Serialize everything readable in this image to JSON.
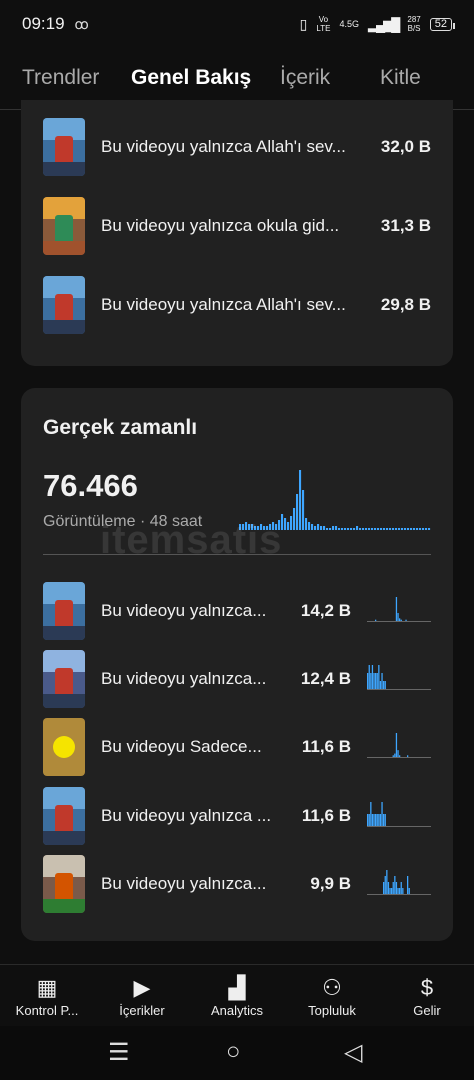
{
  "status_bar": {
    "time": "09:19",
    "link_icon": "link-icon",
    "vo": "Vo",
    "lte": "LTE",
    "network": "4.5G",
    "speed_value": "287",
    "speed_unit": "B/S",
    "battery": "52"
  },
  "tabs": [
    "Trendler",
    "Genel Bakış",
    "İçerik",
    "Kitle"
  ],
  "active_tab": "Genel Bakış",
  "top_list": [
    {
      "title": "Bu videoyu yalnızca Allah'ı sev...",
      "value": "32,0 B"
    },
    {
      "title": "Bu videoyu yalnızca okula gid...",
      "value": "31,3 B"
    },
    {
      "title": "Bu videoyu yalnızca Allah'ı sev...",
      "value": "29,8 B"
    }
  ],
  "realtime": {
    "title": "Gerçek zamanlı",
    "views": "76.466",
    "subtitle": "Görüntüleme · 48 saat",
    "chart_bars": [
      3,
      3,
      4,
      3,
      3,
      2,
      2,
      3,
      2,
      2,
      3,
      4,
      3,
      5,
      8,
      6,
      4,
      7,
      11,
      18,
      30,
      20,
      6,
      4,
      3,
      2,
      3,
      2,
      2,
      1,
      1,
      2,
      2,
      1,
      1,
      1,
      1,
      1,
      1,
      2,
      1,
      1,
      1,
      1,
      1,
      1,
      1,
      1,
      1,
      1,
      1,
      1,
      1,
      1,
      1,
      1,
      1,
      1,
      1,
      1,
      1,
      1,
      1,
      1
    ]
  },
  "realtime_list": [
    {
      "title": "Bu videoyu yalnızca...",
      "value": "14,2 B",
      "spark": [
        0,
        0,
        0,
        0,
        0,
        1,
        0,
        0,
        0,
        0,
        0,
        0,
        0,
        0,
        0,
        0,
        0,
        0,
        18,
        6,
        2,
        1,
        0,
        0,
        1,
        0,
        0,
        0,
        0,
        0,
        0,
        0,
        0,
        0,
        0,
        0,
        0,
        0,
        0,
        0
      ]
    },
    {
      "title": "Bu videoyu yalnızca...",
      "value": "12,4 B",
      "spark": [
        2,
        3,
        2,
        3,
        2,
        2,
        2,
        3,
        1,
        2,
        1,
        1,
        0,
        0,
        0,
        0,
        0,
        0,
        0,
        0,
        0,
        0,
        0,
        0,
        0,
        0,
        0,
        0,
        0,
        0,
        0,
        0,
        0,
        0,
        0,
        0,
        0,
        0,
        0,
        0
      ]
    },
    {
      "title": "Bu videoyu Sadece...",
      "value": "11,6 B",
      "spark": [
        0,
        0,
        0,
        0,
        0,
        0,
        0,
        0,
        0,
        0,
        0,
        0,
        0,
        0,
        0,
        0,
        1,
        2,
        14,
        4,
        1,
        0,
        0,
        0,
        0,
        1,
        0,
        0,
        0,
        0,
        0,
        0,
        0,
        0,
        0,
        0,
        0,
        0,
        0,
        0
      ]
    },
    {
      "title": "Bu videoyu yalnızca ...",
      "value": "11,6 B",
      "spark": [
        1,
        1,
        2,
        1,
        1,
        1,
        1,
        1,
        1,
        2,
        1,
        1,
        0,
        0,
        0,
        0,
        0,
        0,
        0,
        0,
        0,
        0,
        0,
        0,
        0,
        0,
        0,
        0,
        0,
        0,
        0,
        0,
        0,
        0,
        0,
        0,
        0,
        0,
        0,
        0
      ]
    },
    {
      "title": "Bu videoyu yalnızca...",
      "value": "9,9 B",
      "spark": [
        0,
        0,
        0,
        0,
        0,
        0,
        0,
        0,
        0,
        0,
        2,
        3,
        4,
        2,
        1,
        1,
        2,
        3,
        2,
        1,
        1,
        2,
        1,
        0,
        0,
        3,
        1,
        0,
        0,
        0,
        0,
        0,
        0,
        0,
        0,
        0,
        0,
        0,
        0,
        0
      ]
    }
  ],
  "watermark": "itemsatis",
  "bottom_nav": [
    {
      "label": "Kontrol P...",
      "icon": "dashboard-icon"
    },
    {
      "label": "İçerikler",
      "icon": "content-icon"
    },
    {
      "label": "Analytics",
      "icon": "analytics-icon"
    },
    {
      "label": "Topluluk",
      "icon": "community-icon"
    },
    {
      "label": "Gelir",
      "icon": "dollar-icon"
    }
  ],
  "accent_color": "#3ea6ff"
}
